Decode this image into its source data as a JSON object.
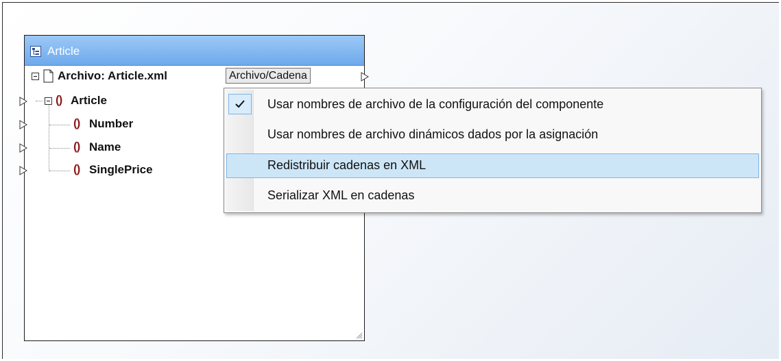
{
  "component": {
    "title": "Article",
    "file_label": "Archivo: Article.xml",
    "file_button": "Archivo/Cadena",
    "tree": [
      {
        "label": "Article"
      },
      {
        "label": "Number"
      },
      {
        "label": "Name"
      },
      {
        "label": "SinglePrice"
      }
    ]
  },
  "menu": {
    "items": [
      {
        "label": "Usar nombres de archivo de la configuración del componente",
        "checked": true
      },
      {
        "label": "Usar nombres de archivo dinámicos dados por la asignación"
      },
      {
        "label": "Redistribuir cadenas en XML",
        "highlighted": true
      },
      {
        "label": "Serializar XML en cadenas"
      }
    ]
  },
  "icons": {
    "title": "schema-component-icon",
    "file": "document-icon",
    "element": "element-braces-icon",
    "port": "connector-port-icon",
    "check": "checkmark-icon"
  },
  "colors": {
    "title_bar": "#7fb5ef",
    "element_icon": "#8b1a1a",
    "menu_highlight": "#cde6f7"
  }
}
